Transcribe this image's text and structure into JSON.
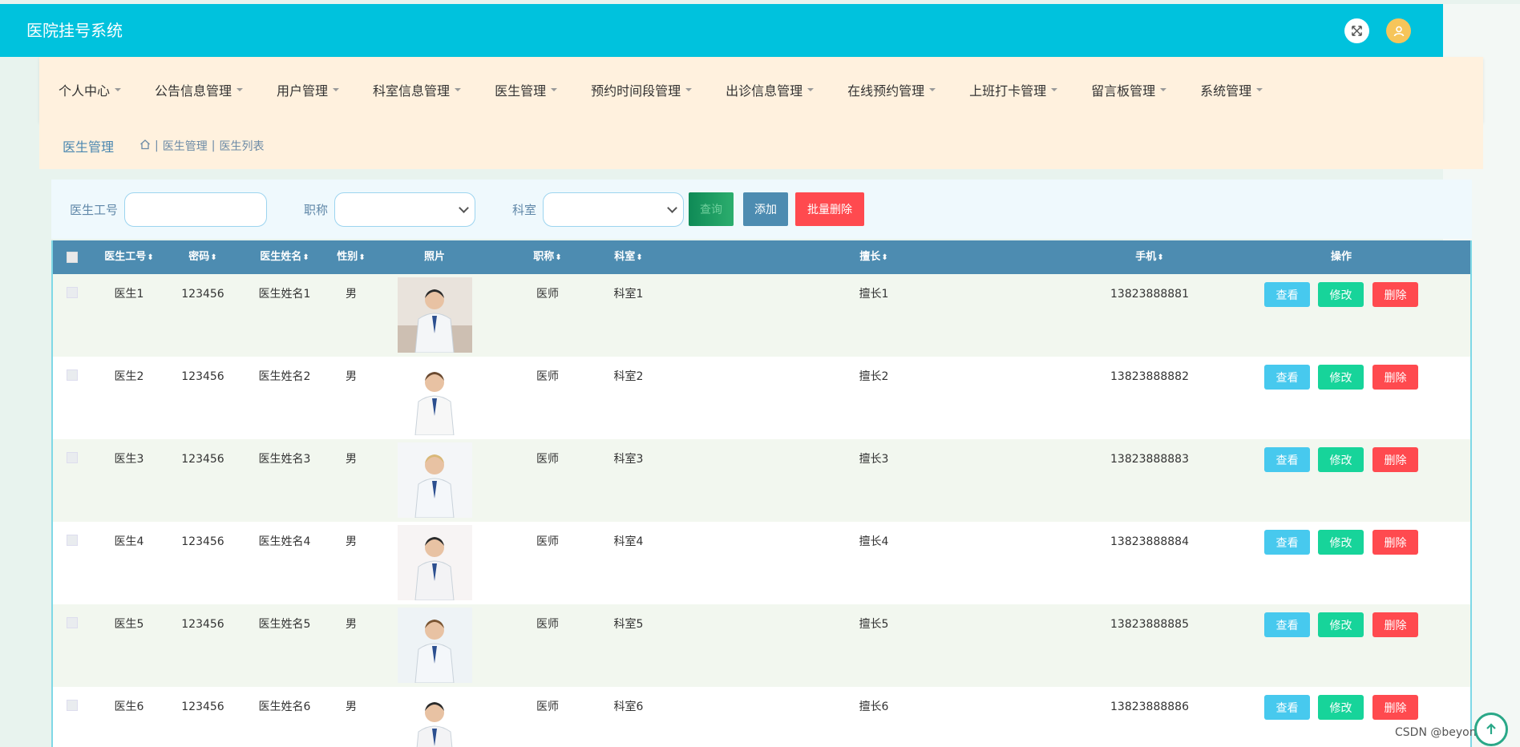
{
  "app": {
    "title": "医院挂号系统"
  },
  "header_icons": {
    "fullscreen": "fullscreen-icon",
    "avatar": "user-avatar-icon"
  },
  "nav": {
    "items": [
      {
        "label": "个人中心"
      },
      {
        "label": "公告信息管理"
      },
      {
        "label": "用户管理"
      },
      {
        "label": "科室信息管理"
      },
      {
        "label": "医生管理"
      },
      {
        "label": "预约时间段管理"
      },
      {
        "label": "出诊信息管理"
      },
      {
        "label": "在线预约管理"
      },
      {
        "label": "上班打卡管理"
      },
      {
        "label": "留言板管理"
      },
      {
        "label": "系统管理"
      }
    ]
  },
  "breadcrumb": {
    "title": "医生管理",
    "home_icon": "home-icon",
    "items": [
      "医生管理",
      "医生列表"
    ],
    "separator": "|"
  },
  "search": {
    "doctor_id_label": "医生工号",
    "doctor_id_value": "",
    "title_label": "职称",
    "title_value": "",
    "dept_label": "科室",
    "dept_value": "",
    "query_button": "查询",
    "add_button": "添加",
    "batch_delete_button": "批量删除"
  },
  "table": {
    "headers": {
      "doctor_id": "医生工号",
      "password": "密码",
      "doctor_name": "医生姓名",
      "gender": "性别",
      "photo": "照片",
      "title": "职称",
      "department": "科室",
      "specialty": "擅长",
      "phone": "手机",
      "actions": "操作"
    },
    "sort_glyph": "⬍",
    "rows": [
      {
        "doctor_id": "医生1",
        "password": "123456",
        "doctor_name": "医生姓名1",
        "gender": "男",
        "title": "医师",
        "department": "科室1",
        "specialty": "擅长1",
        "phone": "13823888881"
      },
      {
        "doctor_id": "医生2",
        "password": "123456",
        "doctor_name": "医生姓名2",
        "gender": "男",
        "title": "医师",
        "department": "科室2",
        "specialty": "擅长2",
        "phone": "13823888882"
      },
      {
        "doctor_id": "医生3",
        "password": "123456",
        "doctor_name": "医生姓名3",
        "gender": "男",
        "title": "医师",
        "department": "科室3",
        "specialty": "擅长3",
        "phone": "13823888883"
      },
      {
        "doctor_id": "医生4",
        "password": "123456",
        "doctor_name": "医生姓名4",
        "gender": "男",
        "title": "医师",
        "department": "科室4",
        "specialty": "擅长4",
        "phone": "13823888884"
      },
      {
        "doctor_id": "医生5",
        "password": "123456",
        "doctor_name": "医生姓名5",
        "gender": "男",
        "title": "医师",
        "department": "科室5",
        "specialty": "擅长5",
        "phone": "13823888885"
      },
      {
        "doctor_id": "医生6",
        "password": "123456",
        "doctor_name": "医生姓名6",
        "gender": "男",
        "title": "医师",
        "department": "科室6",
        "specialty": "擅长6",
        "phone": "13823888886"
      }
    ],
    "row_actions": {
      "view": "查看",
      "edit": "修改",
      "delete": "删除"
    }
  },
  "watermark": "CSDN @beyondwild",
  "colors": {
    "topbar": "#00c2dd",
    "nav_bg": "#fff1de",
    "table_header": "#4d8cb1",
    "view": "#47c9ee",
    "edit": "#17d49a",
    "delete": "#ff4a4f"
  }
}
